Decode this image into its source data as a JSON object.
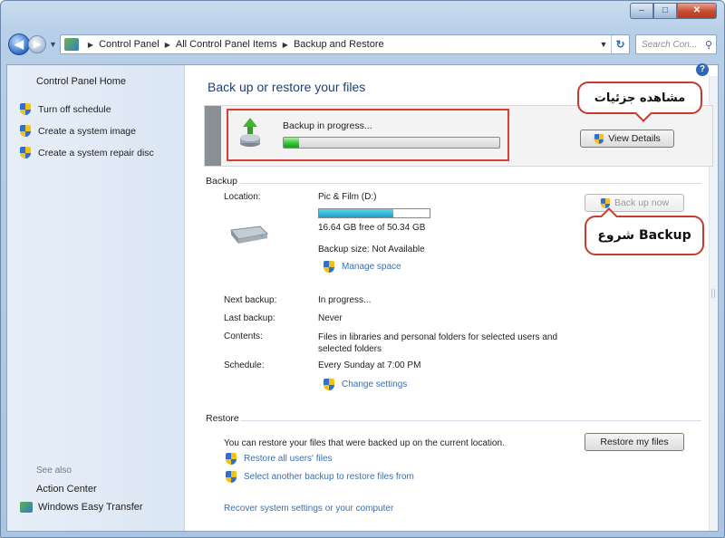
{
  "window": {
    "min_glyph": "–",
    "max_glyph": "□",
    "close_glyph": "✕"
  },
  "address": {
    "crumbs": [
      "Control Panel",
      "All Control Panel Items",
      "Backup and Restore"
    ],
    "search_placeholder": "Search Con..."
  },
  "sidebar": {
    "home": "Control Panel Home",
    "items": [
      {
        "label": "Turn off schedule",
        "icon": "shield-icon"
      },
      {
        "label": "Create a system image",
        "icon": "shield-icon"
      },
      {
        "label": "Create a system repair disc",
        "icon": "shield-icon"
      }
    ],
    "see_also": "See also",
    "action_center": "Action Center",
    "easy_transfer": "Windows Easy Transfer"
  },
  "main": {
    "title": "Back up or restore your files",
    "progress_label": "Backup in progress...",
    "progress_fraction": 0.07,
    "view_details": "View Details",
    "callout_details": "مشاهده جزئیات",
    "callout_backup": "شروع Backup",
    "backup_section": "Backup",
    "location_key": "Location:",
    "location_val": "Pic & Film (D:)",
    "disk_used_fraction": 0.67,
    "free_space": "16.64 GB free of 50.34 GB",
    "backup_size": "Backup size: Not Available",
    "manage_space": "Manage space",
    "back_up_now": "Back up now",
    "next_key": "Next backup:",
    "next_val": "In progress...",
    "last_key": "Last backup:",
    "last_val": "Never",
    "contents_key": "Contents:",
    "contents_val": "Files in libraries and personal folders for selected users and selected folders",
    "schedule_key": "Schedule:",
    "schedule_val": "Every Sunday at 7:00 PM",
    "change_settings": "Change settings",
    "restore_section": "Restore",
    "restore_text": "You can restore your files that were backed up on the current location.",
    "restore_my_files": "Restore my files",
    "restore_all_users": "Restore all users' files",
    "select_another": "Select another backup to restore files from",
    "recover_link": "Recover system settings or your computer"
  }
}
